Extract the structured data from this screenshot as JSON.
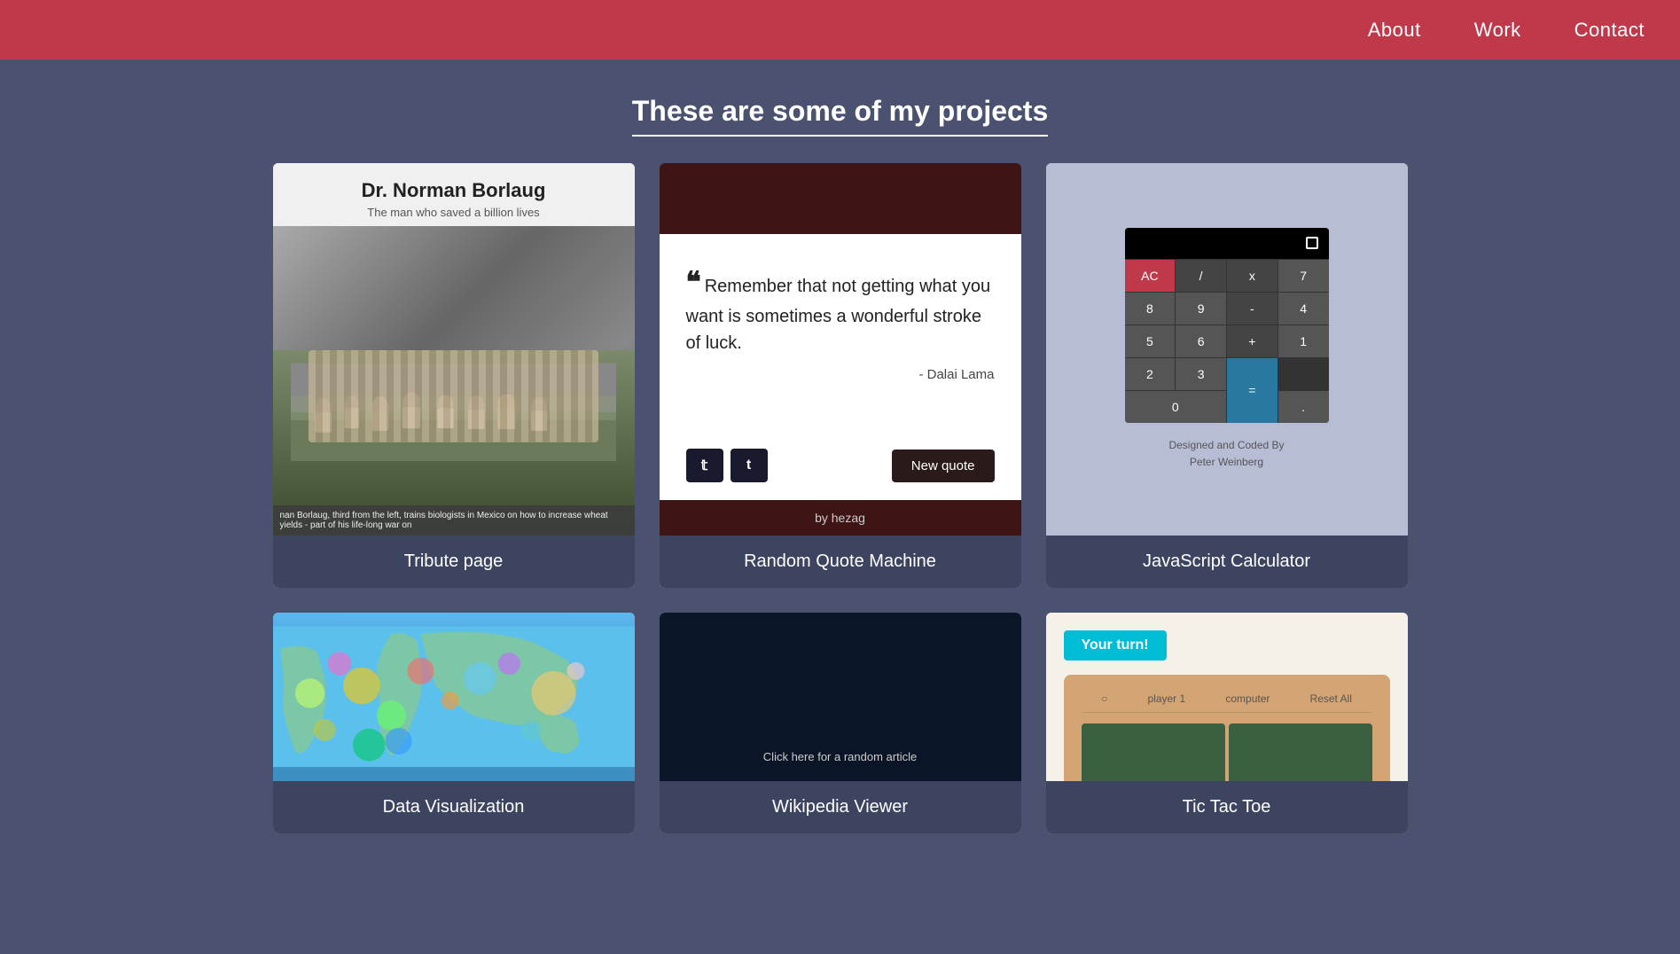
{
  "nav": {
    "links": [
      {
        "id": "about",
        "label": "About"
      },
      {
        "id": "work",
        "label": "Work"
      },
      {
        "id": "contact",
        "label": "Contact"
      }
    ]
  },
  "page": {
    "title": "These are some of my projects"
  },
  "projects": [
    {
      "id": "tribute-page",
      "label": "Tribute page",
      "title": "Dr. Norman Borlaug",
      "subtitle": "The man who saved a billion lives",
      "caption": "nan Borlaug, third from the left, trains biologists in Mexico on how to increase wheat yields - part of his life-long war on"
    },
    {
      "id": "random-quote-machine",
      "label": "Random Quote Machine",
      "quote": "Remember that not getting what you want is sometimes a wonderful stroke of luck.",
      "author": "- Dalai Lama",
      "twitter_label": "t",
      "tumblr_label": "t",
      "new_quote_label": "New quote",
      "by_label": "by hezag"
    },
    {
      "id": "javascript-calculator",
      "label": "JavaScript Calculator",
      "credit_line1": "Designed and Coded By",
      "credit_line2": "Peter Weinberg",
      "buttons": [
        "AC",
        "/",
        "x",
        "7",
        "8",
        "9",
        "-",
        "4",
        "5",
        "6",
        "+",
        "1",
        "2",
        "3",
        "=",
        "0",
        ".",
        "="
      ]
    },
    {
      "id": "data-visualization",
      "label": "Data Visualization"
    },
    {
      "id": "wikipedia-viewer",
      "label": "Wikipedia Viewer",
      "click_text": "Click here for a random article"
    },
    {
      "id": "tic-tac-toe",
      "label": "Tic Tac Toe",
      "your_turn": "Your turn!",
      "player1": "player 1",
      "computer": "computer",
      "reset": "Reset All"
    }
  ]
}
